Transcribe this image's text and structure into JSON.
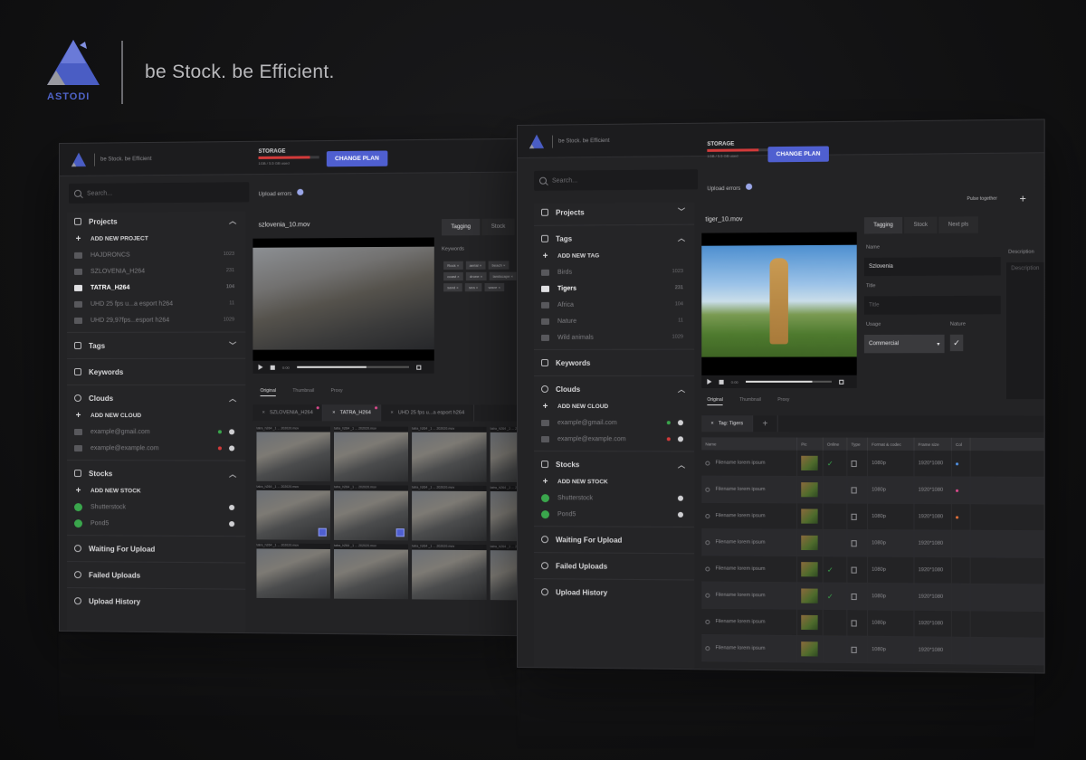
{
  "brand": {
    "logo_text": "ASTODI",
    "tagline": "be Stock. be Efficient.",
    "accent": "#4f63c9"
  },
  "left_window": {
    "mini_tagline": "be Stock. be Efficient",
    "storage": {
      "label": "STORAGE",
      "sub": "1GB / 5.5 GB used",
      "fill": 0.85
    },
    "plan_button": "CHANGE PLAN",
    "search_placeholder": "Search...",
    "upload_errors": "Upload errors",
    "sidebar": {
      "projects_title": "Projects",
      "add_project": "ADD NEW PROJECT",
      "projects": [
        {
          "name": "HAJDRONCS",
          "count": "1023",
          "active": false
        },
        {
          "name": "SZLOVENIA_H264",
          "count": "231",
          "active": false
        },
        {
          "name": "TATRA_H264",
          "count": "104",
          "active": true
        },
        {
          "name": "UHD 25 fps u...a esport h264",
          "count": "11",
          "active": false
        },
        {
          "name": "UHD 29,97fps...esport h264",
          "count": "1029",
          "active": false
        }
      ],
      "tags_title": "Tags",
      "keywords_title": "Keywords",
      "clouds_title": "Clouds",
      "add_cloud": "ADD NEW CLOUD",
      "clouds": [
        {
          "email": "example@gmail.com",
          "status_color": "#3aa64c"
        },
        {
          "email": "example@example.com",
          "status_color": "#d23a3a"
        }
      ],
      "stocks_title": "Stocks",
      "add_stock": "ADD NEW STOCK",
      "stocks": [
        "Shutterstock",
        "Pond5"
      ],
      "waiting": "Waiting For Upload",
      "failed": "Failed Uploads",
      "history": "Upload History"
    },
    "file_title": "szlovenia_10.mov",
    "tabs": [
      "Tagging",
      "Stock"
    ],
    "keywords_label": "Keywords",
    "subtabs": [
      "Original",
      "Thumbnail",
      "Proxy"
    ],
    "filetabs": [
      "SZLOVENIA_H264",
      "TATRA_H264",
      "UHD 25 fps u...a esport h264"
    ],
    "thumb_caption": "tatra_h264 _1 ... 202020.mov",
    "player_progress": 0.62
  },
  "right_window": {
    "mini_tagline": "be Stock. be Efficient",
    "storage": {
      "label": "STORAGE",
      "sub": "1GB / 5.5 GB used",
      "fill": 0.85
    },
    "plan_button": "CHANGE PLAN",
    "search_placeholder": "Search...",
    "upload_errors": "Upload errors",
    "top_right_label": "Pulse together",
    "sidebar": {
      "projects_title": "Projects",
      "tags_title": "Tags",
      "add_tag": "ADD NEW TAG",
      "tags": [
        {
          "name": "Birds",
          "count": "1023",
          "active": false
        },
        {
          "name": "Tigers",
          "count": "231",
          "active": true
        },
        {
          "name": "Africa",
          "count": "104",
          "active": false
        },
        {
          "name": "Nature",
          "count": "11",
          "active": false
        },
        {
          "name": "Wild animals",
          "count": "1029",
          "active": false
        }
      ],
      "keywords_title": "Keywords",
      "clouds_title": "Clouds",
      "add_cloud": "ADD NEW CLOUD",
      "clouds": [
        {
          "email": "example@gmail.com",
          "status_color": "#3aa64c"
        },
        {
          "email": "example@example.com",
          "status_color": "#d23a3a"
        }
      ],
      "stocks_title": "Stocks",
      "add_stock": "ADD NEW STOCK",
      "stocks": [
        "Shutterstock",
        "Pond5"
      ],
      "waiting": "Waiting For Upload",
      "failed": "Failed Uploads",
      "history": "Upload History"
    },
    "file_title": "tiger_10.mov",
    "tabs": [
      "Tagging",
      "Stock",
      "Next pls"
    ],
    "form": {
      "name_label": "Name",
      "name_value": "Szlovenia",
      "title_label": "Title",
      "title_placeholder": "Title",
      "usage_label": "Usage",
      "usage_value": "Commercial",
      "nature_label": "Nature",
      "description_label": "Description",
      "description_placeholder": "Description"
    },
    "subtabs": [
      "Original",
      "Thumbnail",
      "Proxy"
    ],
    "tag_tab": "Tag: Tigers",
    "table": {
      "headers": [
        "Name",
        "Pic",
        "Online",
        "Type",
        "Format & codec",
        "Frame size",
        "Col"
      ],
      "rows": [
        {
          "name": "Filename lorem ipsum",
          "online": true,
          "codec": "1080p",
          "size": "1920*1080",
          "color": "#4f8fe0"
        },
        {
          "name": "Filename lorem ipsum",
          "online": false,
          "codec": "1080p",
          "size": "1920*1080",
          "color": "#d94a8c"
        },
        {
          "name": "Filename lorem ipsum",
          "online": false,
          "codec": "1080p",
          "size": "1920*1080",
          "color": "#e0703a"
        },
        {
          "name": "Filename lorem ipsum",
          "online": false,
          "codec": "1080p",
          "size": "1920*1080",
          "color": ""
        },
        {
          "name": "Filename lorem ipsum",
          "online": true,
          "codec": "1080p",
          "size": "1920*1080",
          "color": ""
        },
        {
          "name": "Filename lorem ipsum",
          "online": true,
          "codec": "1080p",
          "size": "1920*1080",
          "color": ""
        },
        {
          "name": "Filename lorem ipsum",
          "online": false,
          "codec": "1080p",
          "size": "1920*1080",
          "color": ""
        },
        {
          "name": "Filename lorem ipsum",
          "online": false,
          "codec": "1080p",
          "size": "1920*1080",
          "color": ""
        }
      ]
    },
    "player_progress": 0.78
  }
}
